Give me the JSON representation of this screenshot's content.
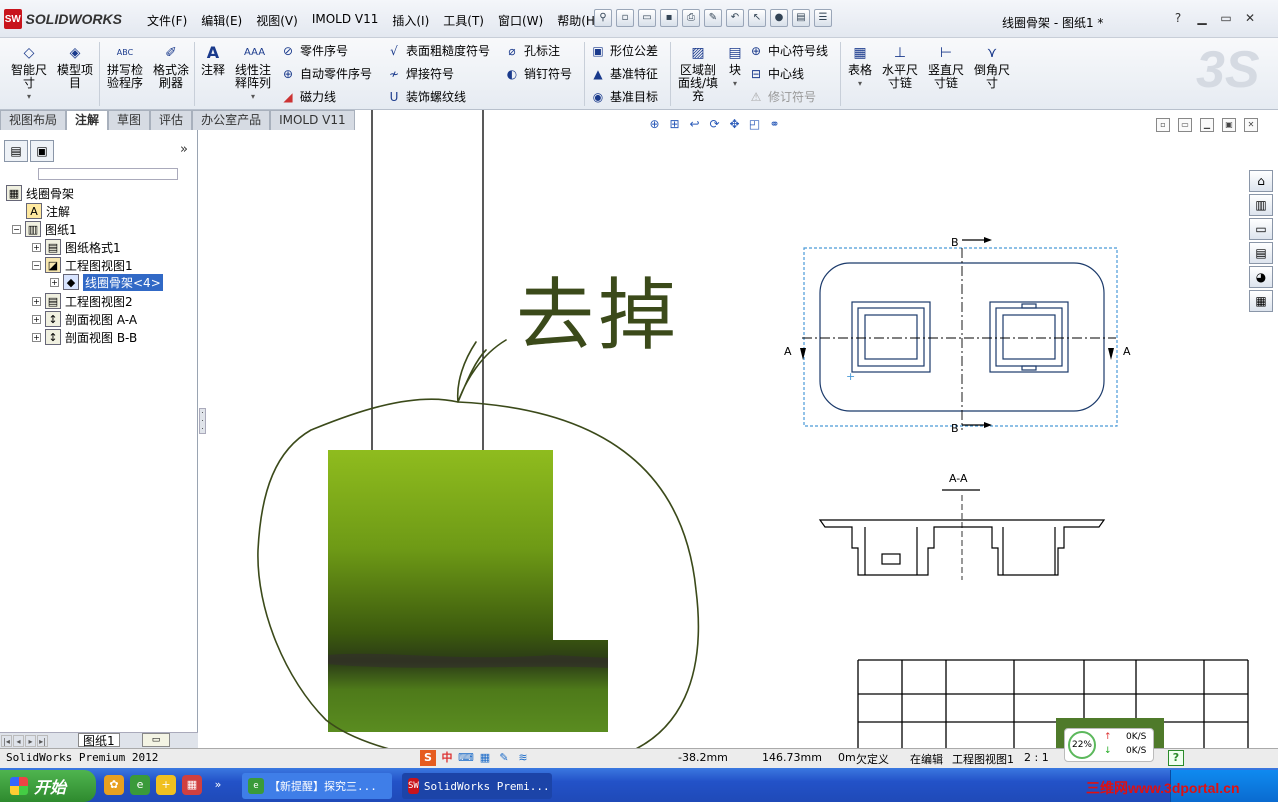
{
  "app": {
    "logo_label": "SOLIDWORKS",
    "document_title": "线圈骨架 - 图纸1 *"
  },
  "menu": {
    "items": [
      "文件(F)",
      "编辑(E)",
      "视图(V)",
      "IMOLD V11",
      "插入(I)",
      "工具(T)",
      "窗口(W)",
      "帮助(H)"
    ]
  },
  "command_manager": {
    "smart_dim_line1": "智能尺",
    "smart_dim_line2": "寸",
    "model_items_line1": "模型项",
    "model_items_line2": "目",
    "spell_check_line1": "拼写检",
    "spell_check_line2": "验程序",
    "format_painter_line1": "格式涂",
    "format_painter_line2": "刷器",
    "note": "注释",
    "linear_pattern_line1": "线性注",
    "linear_pattern_line2": "释阵列",
    "balloon": "零件序号",
    "auto_balloon": "自动零件序号",
    "magnetic_line": "磁力线",
    "surface_finish": "表面粗糙度符号",
    "weld_symbol": "焊接符号",
    "cosmetic_thread": "装饰螺纹线",
    "hole_callout": "孔标注",
    "dowel_pin": "销钉符号",
    "gtol": "形位公差",
    "datum_feature": "基准特征",
    "datum_target": "基准目标",
    "area_hatch_line1": "区域剖",
    "area_hatch_line2": "面线/填",
    "area_hatch_line3": "充",
    "block": "块",
    "center_mark": "中心符号线",
    "centerline": "中心线",
    "revision_symbol": "修订符号",
    "tables": "表格",
    "horiz_chain_line1": "水平尺",
    "horiz_chain_line2": "寸链",
    "vert_chain_line1": "竖直尺",
    "vert_chain_line2": "寸链",
    "chamfer_dim_line1": "倒角尺",
    "chamfer_dim_line2": "寸"
  },
  "tabs": [
    "视图布局",
    "注解",
    "草图",
    "评估",
    "办公室产品",
    "IMOLD V11"
  ],
  "tree": {
    "root": "线圈骨架",
    "annotations": "注解",
    "sheet": "图纸1",
    "sheet_format": "图纸格式1",
    "drawing_view1": "工程图视图1",
    "part_ref": "线圈骨架<4>",
    "drawing_view2": "工程图视图2",
    "section_aa": "剖面视图 A-A",
    "section_bb": "剖面视图 B-B"
  },
  "sheet_tab": "图纸1",
  "handwriting": "去掉",
  "drawing": {
    "label_a_left": "A",
    "label_a_right": "A",
    "label_b_top": "B",
    "label_b_bottom": "B",
    "section_title": "A-A"
  },
  "status": {
    "app_name": "SolidWorks Premium 2012",
    "x": "-38.2mm",
    "y": "146.73mm",
    "z": "0m",
    "defined": "欠定义",
    "editing": "在编辑",
    "editing_target": "工程图视图1",
    "scale": "2 : 1"
  },
  "netmon": {
    "percent": "22%",
    "up": "0K/S",
    "down": "0K/S"
  },
  "taskbar": {
    "start": "开始",
    "task1": "【新提醒】探究三...",
    "task2": "SolidWorks Premi..."
  },
  "watermark": "三维网www.3dportal.cn",
  "colors": {
    "drawing_line": "#1b3a6b",
    "selection_dashed": "#4a9ad8",
    "annotation_ink": "#3b4a1a",
    "taskbar": "#2352c8",
    "start_button": "#3a9a3a"
  }
}
